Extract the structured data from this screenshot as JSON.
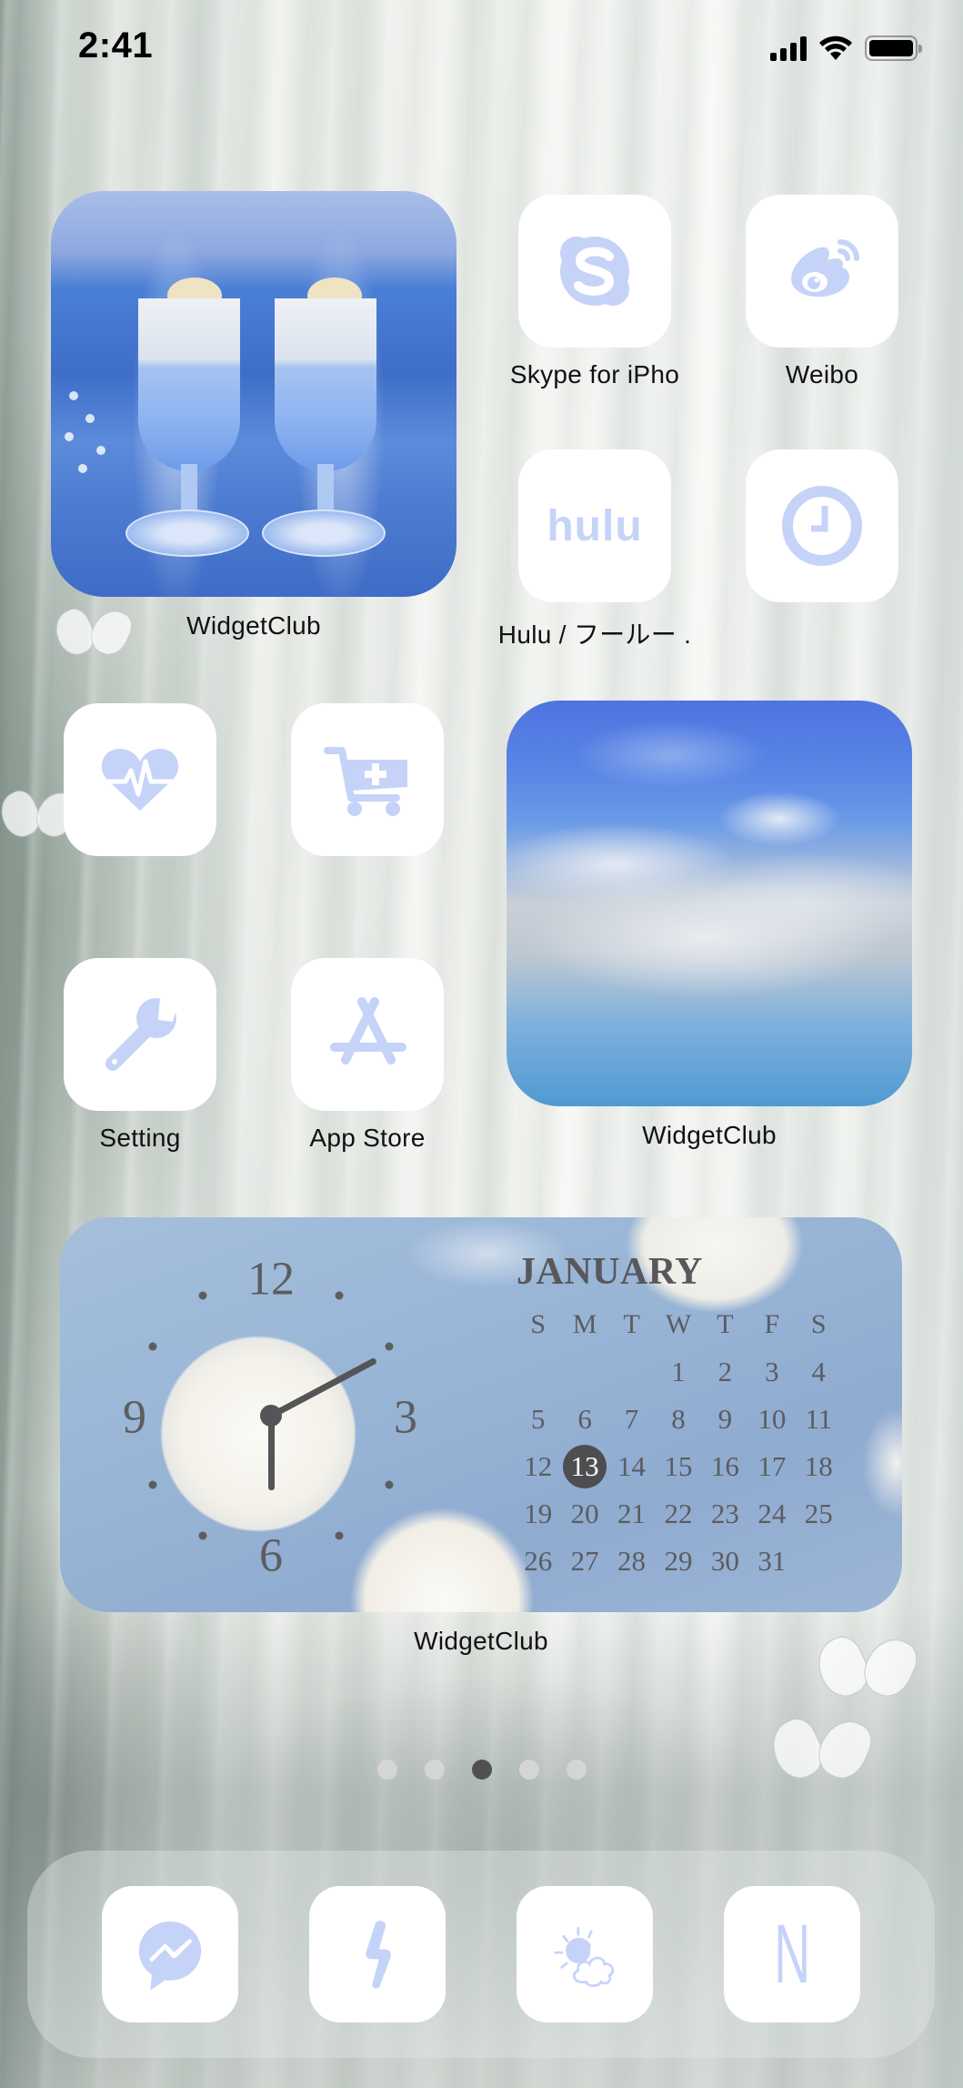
{
  "status_bar": {
    "time": "2:41",
    "signal_icon": "cellular-signal-icon",
    "wifi_icon": "wifi-icon",
    "battery_icon": "battery-full-icon"
  },
  "theme": {
    "icon_tint": "#c5d3f8",
    "tile_background": "#ffffff",
    "label_color": "#111111",
    "widget_text_color": "#5c5c60",
    "today_highlight": "#4e4e50"
  },
  "widgets": {
    "drinks_photo": {
      "label": "WidgetClub",
      "content": "photo of two glasses of blue cream soda by the sea"
    },
    "sky_photo": {
      "label": "WidgetClub",
      "content": "photo of blue sky with clouds"
    },
    "clock_calendar": {
      "label": "WidgetClub",
      "clock": {
        "numerals": [
          "12",
          "3",
          "6",
          "9"
        ],
        "hour_hand_hours": 6.0,
        "minute_hand_minutes": 5
      },
      "calendar": {
        "month": "JANUARY",
        "weekdays": [
          "S",
          "M",
          "T",
          "W",
          "T",
          "F",
          "S"
        ],
        "weeks": [
          [
            "",
            "",
            "",
            "1",
            "2",
            "3",
            "4"
          ],
          [
            "5",
            "6",
            "7",
            "8",
            "9",
            "10",
            "11"
          ],
          [
            "12",
            "13",
            "14",
            "15",
            "16",
            "17",
            "18"
          ],
          [
            "19",
            "20",
            "21",
            "22",
            "23",
            "24",
            "25"
          ],
          [
            "26",
            "27",
            "28",
            "29",
            "30",
            "31",
            ""
          ]
        ],
        "today": "13"
      }
    }
  },
  "apps": [
    {
      "label": "Skype for iPhone",
      "display_label": "Skype for iPho",
      "icon": "skype-icon"
    },
    {
      "label": "Weibo",
      "display_label": "Weibo",
      "icon": "weibo-icon"
    },
    {
      "label": "Hulu / フールー",
      "display_label": "Hulu / フールー .",
      "icon": "hulu-icon",
      "icon_text": "hulu"
    },
    {
      "label": "",
      "display_label": "",
      "icon": "clock-icon"
    },
    {
      "label": "",
      "display_label": "",
      "icon": "health-heart-icon"
    },
    {
      "label": "",
      "display_label": "",
      "icon": "shopping-cart-add-icon"
    },
    {
      "label": "Setting",
      "display_label": "Setting",
      "icon": "wrench-icon"
    },
    {
      "label": "App Store",
      "display_label": "App Store",
      "icon": "app-store-icon"
    }
  ],
  "page_indicator": {
    "count": 5,
    "active_index": 2
  },
  "dock": [
    {
      "icon": "messenger-icon"
    },
    {
      "icon": "lightning-bolt-icon"
    },
    {
      "icon": "weather-partly-cloudy-icon"
    },
    {
      "icon": "netflix-icon",
      "icon_text": "N"
    }
  ]
}
